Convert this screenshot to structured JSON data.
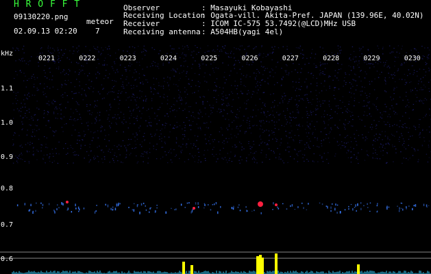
{
  "header": {
    "title": "H R O F F T",
    "filename": "09130220.png",
    "datetime": "02.09.13 02:20",
    "meteor_label": "meteor",
    "meteor_count": "7"
  },
  "info": [
    {
      "key": "Observer",
      "value": ": Masayuki Kobayashi"
    },
    {
      "key": "Receiving Location",
      "value": ": Ogata-vill. Akita-Pref. JAPAN (139.96E, 40.02N)"
    },
    {
      "key": "Receiver",
      "value": ": ICOM IC-575 53.7492(@LCD)MHz USB"
    },
    {
      "key": "Receiving antenna",
      "value": ": A504HB(yagi 4el)"
    }
  ],
  "axis": {
    "y_unit": "kHz",
    "y_ticks": [
      "1.1",
      "1.0",
      "0.9",
      "0.8",
      "0.7",
      "0.6"
    ],
    "x_ticks": [
      "0221",
      "0222",
      "0223",
      "0224",
      "0225",
      "0226",
      "0227",
      "0228",
      "0229",
      "0230"
    ]
  },
  "colors": {
    "background": "#000000",
    "noise": "#1c1c6a",
    "signal": "#3a7cff",
    "meteor_head": "#ff2040",
    "title": "#39ff3c",
    "level_trace": "#35d0ff",
    "level_peak": "#ffff00"
  }
}
